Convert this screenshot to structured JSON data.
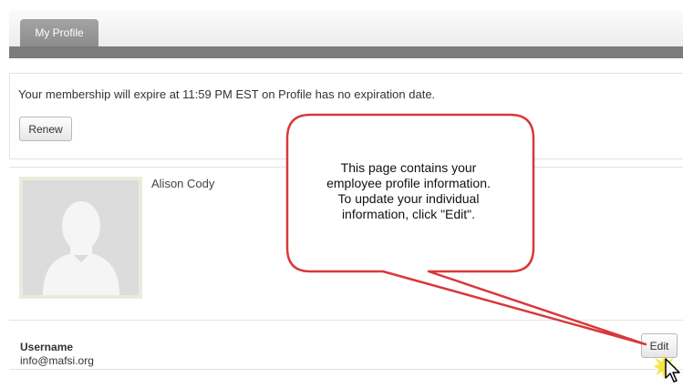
{
  "tabs": [
    {
      "label": "My Profile"
    }
  ],
  "membership": {
    "message": "Your membership will expire at 11:59 PM EST on Profile has no expiration date.",
    "renew_label": "Renew"
  },
  "profile": {
    "name": "Alison Cody",
    "avatar_icon": "person-silhouette-icon"
  },
  "account": {
    "username_label": "Username",
    "username_value": "info@mafsi.org",
    "edit_label": "Edit"
  },
  "callout": {
    "line1": "This page contains your",
    "line2": "employee profile information.",
    "line3": "To update your individual",
    "line4": "information, click \"Edit\".",
    "border_color": "#d9383a"
  },
  "cursor": {
    "icon": "mouse-pointer-icon",
    "highlight_icon": "click-sparkle-icon",
    "highlight_color": "#f5e52a"
  }
}
